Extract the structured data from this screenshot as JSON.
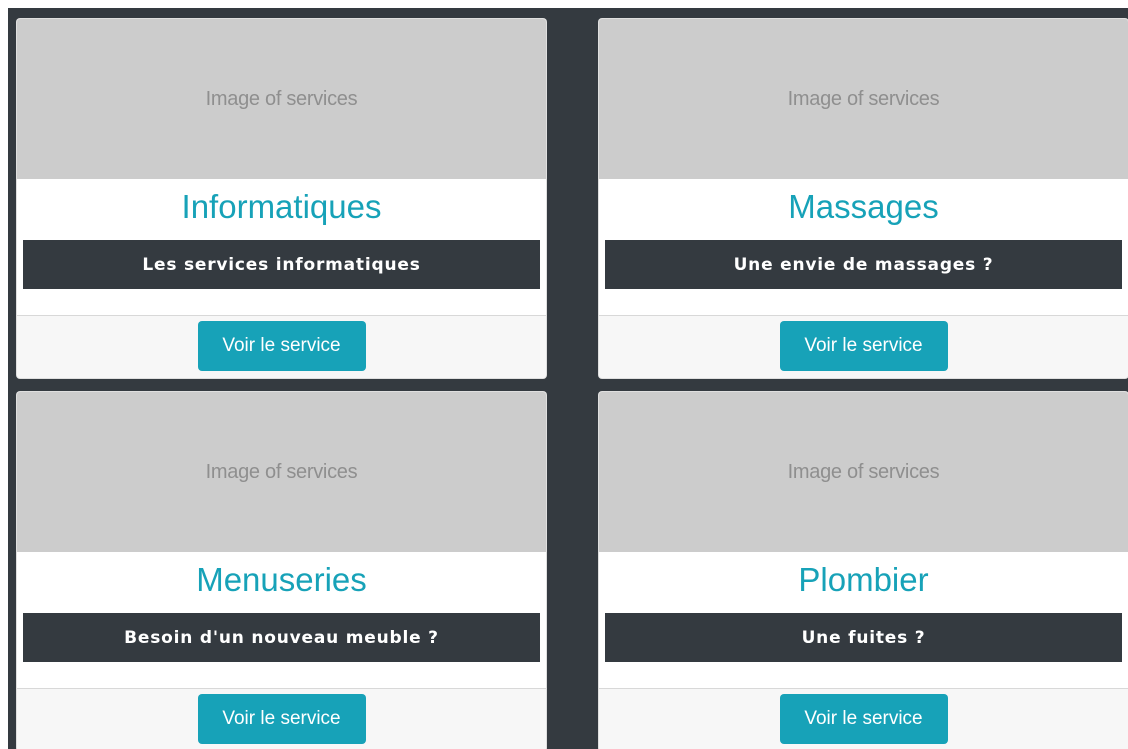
{
  "services": [
    {
      "image_alt": "Image of services",
      "title": "Informatiques",
      "description": "Les services informatiques",
      "button_label": "Voir le service"
    },
    {
      "image_alt": "Image of services",
      "title": "Massages",
      "description": "Une envie de massages ?",
      "button_label": "Voir le service"
    },
    {
      "image_alt": "Image of services",
      "title": "Menuseries",
      "description": "Besoin d'un nouveau meuble ?",
      "button_label": "Voir le service"
    },
    {
      "image_alt": "Image of services",
      "title": "Plombier",
      "description": "Une fuites ?",
      "button_label": "Voir le service"
    }
  ],
  "colors": {
    "accent": "#17a2b8",
    "panel_background": "#343a40",
    "image_placeholder": "#cccccc",
    "footer_background": "#f7f7f7"
  }
}
